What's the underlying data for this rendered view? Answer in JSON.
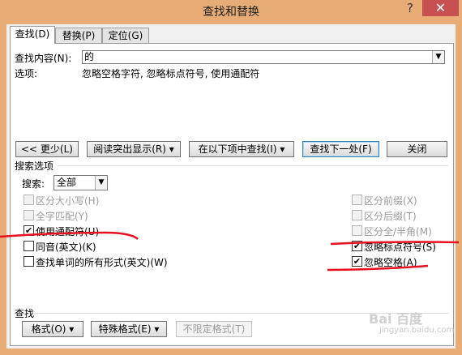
{
  "window": {
    "title": "查找和替换",
    "help": "?",
    "close": "✕"
  },
  "tabs": [
    {
      "label": "查找(D)"
    },
    {
      "label": "替换(P)"
    },
    {
      "label": "定位(G)"
    }
  ],
  "find": {
    "label": "查找内容(N):",
    "value": "的",
    "options_label": "选项:",
    "options_value": "忽略空格字符, 忽略标点符号, 使用通配符"
  },
  "buttons": {
    "less": "<< 更少(L)",
    "reading_highlight": "阅读突出显示(R)",
    "find_in": "在以下项中查找(I)",
    "find_next": "查找下一处(F)",
    "close": "关闭"
  },
  "search_options": {
    "header": "搜索选项",
    "search_label": "搜索:",
    "search_value": "全部"
  },
  "checkboxes_left": [
    {
      "label": "区分大小写(H)",
      "checked": false,
      "disabled": true
    },
    {
      "label": "全字匹配(Y)",
      "checked": false,
      "disabled": true
    },
    {
      "label": "使用通配符(U)",
      "checked": true,
      "disabled": false
    },
    {
      "label": "同音(英文)(K)",
      "checked": false,
      "disabled": false
    },
    {
      "label": "查找单词的所有形式(英文)(W)",
      "checked": false,
      "disabled": false
    }
  ],
  "checkboxes_right": [
    {
      "label": "区分前缀(X)",
      "checked": false,
      "disabled": true
    },
    {
      "label": "区分后缀(T)",
      "checked": false,
      "disabled": true
    },
    {
      "label": "区分全/半角(M)",
      "checked": false,
      "disabled": true
    },
    {
      "label": "忽略标点符号(S)",
      "checked": true,
      "disabled": false
    },
    {
      "label": "忽略空格(A)",
      "checked": true,
      "disabled": false
    }
  ],
  "find_section": {
    "header": "查找",
    "format": "格式(O)",
    "special": "特殊格式(E)",
    "no_format": "不限定格式(T)"
  },
  "watermark": {
    "text": "Bai 百度",
    "sub": "jingyan.baidu.com"
  },
  "colors": {
    "annotation": "#e8101e",
    "title_bg": "#e8ac77",
    "close_bg": "#c75050"
  }
}
